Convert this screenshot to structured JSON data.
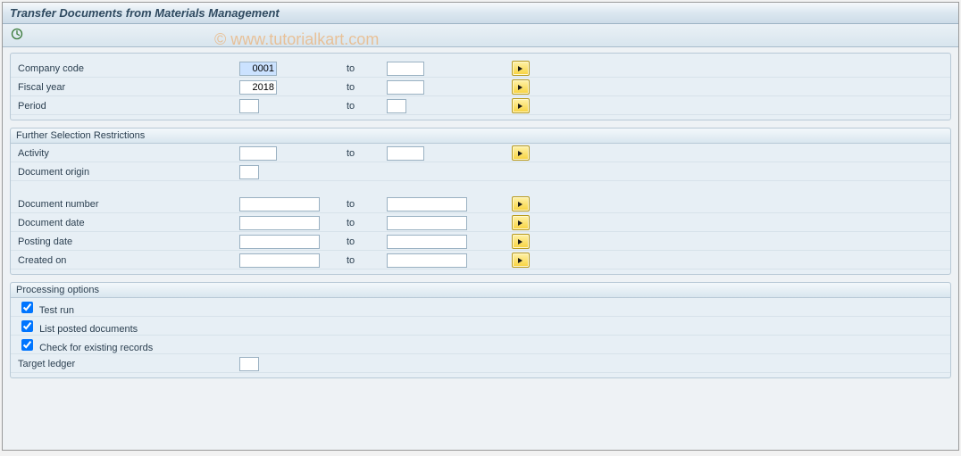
{
  "title": "Transfer Documents from Materials Management",
  "watermark": "© www.tutorialkart.com",
  "top": {
    "company_code": {
      "label": "Company code",
      "from": "0001",
      "to": "",
      "to_label": "to"
    },
    "fiscal_year": {
      "label": "Fiscal year",
      "from": "2018",
      "to": "",
      "to_label": "to"
    },
    "period": {
      "label": "Period",
      "from": "",
      "to": "",
      "to_label": "to"
    }
  },
  "further": {
    "title": "Further Selection Restrictions",
    "activity": {
      "label": "Activity",
      "from": "",
      "to": "",
      "to_label": "to"
    },
    "document_origin": {
      "label": "Document origin",
      "from": ""
    },
    "document_number": {
      "label": "Document number",
      "from": "",
      "to": "",
      "to_label": "to"
    },
    "document_date": {
      "label": "Document date",
      "from": "",
      "to": "",
      "to_label": "to"
    },
    "posting_date": {
      "label": "Posting date",
      "from": "",
      "to": "",
      "to_label": "to"
    },
    "created_on": {
      "label": "Created on",
      "from": "",
      "to": "",
      "to_label": "to"
    }
  },
  "processing": {
    "title": "Processing options",
    "test_run": {
      "label": "Test run",
      "checked": true
    },
    "list_posted": {
      "label": "List posted documents",
      "checked": true
    },
    "check_exist": {
      "label": "Check for existing records",
      "checked": true
    },
    "target_ledger": {
      "label": "Target ledger",
      "value": ""
    }
  }
}
